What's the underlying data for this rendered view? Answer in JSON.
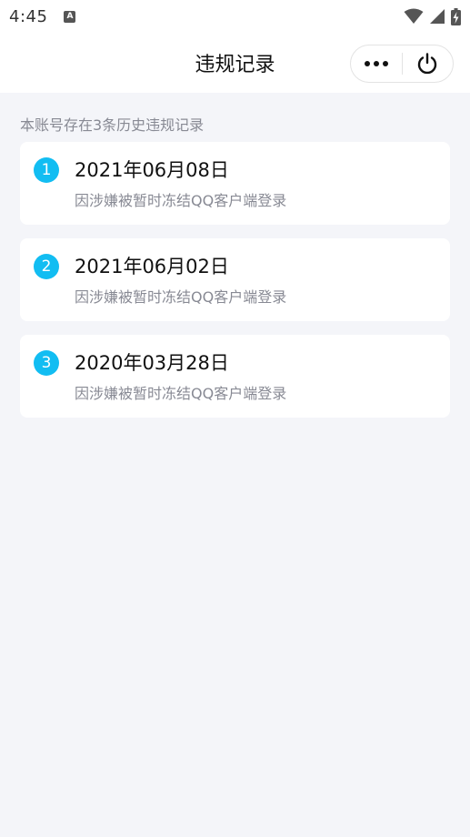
{
  "status_bar": {
    "time": "4:45",
    "a_icon_letter": "A",
    "icons": [
      "notification-a-icon",
      "wifi-icon",
      "signal-icon",
      "battery-charging-icon"
    ]
  },
  "nav": {
    "title": "违规记录",
    "more_icon": "more-dots-icon",
    "close_icon": "power-icon"
  },
  "summary": "本账号存在3条历史违规记录",
  "records": [
    {
      "index": "1",
      "date": "2021年06月08日",
      "reason": "因涉嫌被暂时冻结QQ客户端登录"
    },
    {
      "index": "2",
      "date": "2021年06月02日",
      "reason": "因涉嫌被暂时冻结QQ客户端登录"
    },
    {
      "index": "3",
      "date": "2020年03月28日",
      "reason": "因涉嫌被暂时冻结QQ客户端登录"
    }
  ],
  "colors": {
    "accent": "#12bdf2",
    "background": "#f4f5f9",
    "card": "#ffffff",
    "secondary_text": "#888a94"
  }
}
